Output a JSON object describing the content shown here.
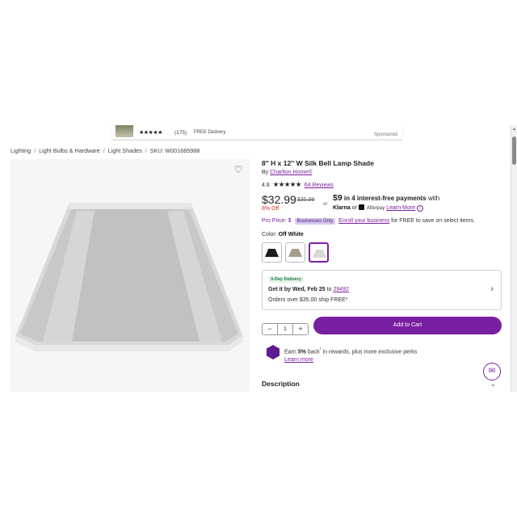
{
  "ad": {
    "stars": "★★★★★",
    "review_count": "(175)",
    "delivery": "FREE Delivery",
    "sponsored": "Sponsored"
  },
  "breadcrumb": {
    "items": [
      "Lighting",
      "Light Bulbs & Hardware",
      "Light Shades"
    ],
    "separator": "/",
    "sku": "SKU: W001685988"
  },
  "product": {
    "title": "8'' H x 12'' W Silk Bell Lamp Shade",
    "by_prefix": "By",
    "brand": "Charlton Home®",
    "rating": "4.8",
    "stars": "★★★★★",
    "reviews_link": "64 Reviews",
    "price": "$32.99",
    "old_price": "$35.99",
    "discount": "8% Off",
    "or_text": "or",
    "installment_amount": "$9",
    "installment_text": "in 4 interest-free payments",
    "installment_suffix": "with",
    "klarna": "Klarna",
    "or_text2": "or",
    "afterpay": "Afterpay",
    "learn_more": "Learn More",
    "pro_price_label": "Pro Price: $",
    "businesses_only": "Businesses Only",
    "enroll_link": "Enroll your business",
    "enroll_suffix": "for FREE to save on select items.",
    "color_label": "Color:",
    "color_value": "Off White",
    "swatches": [
      {
        "name": "Black",
        "color": "#1c1c1c"
      },
      {
        "name": "Beige",
        "color": "#a39c8a"
      },
      {
        "name": "Off White",
        "color": "#d8d8d8"
      }
    ]
  },
  "delivery": {
    "badge": "3-Day Delivery",
    "get_it_prefix": "Get it by",
    "date": "Wed, Feb 25",
    "to_text": "to",
    "zip": "29492",
    "free_ship": "Orders over $35.00 ship FREE*"
  },
  "cart": {
    "qty_minus": "−",
    "qty_value": "1",
    "qty_plus": "+",
    "add_to_cart": "Add to Cart"
  },
  "rewards": {
    "earn": "Earn",
    "percent": "5%",
    "back": "back",
    "sup": "¹",
    "rest": "in rewards, plus more exclusive perks",
    "learn_more": "Learn more"
  },
  "description": {
    "heading": "Description"
  },
  "colors": {
    "accent": "#7b1fa2",
    "discount": "#c0392b"
  }
}
